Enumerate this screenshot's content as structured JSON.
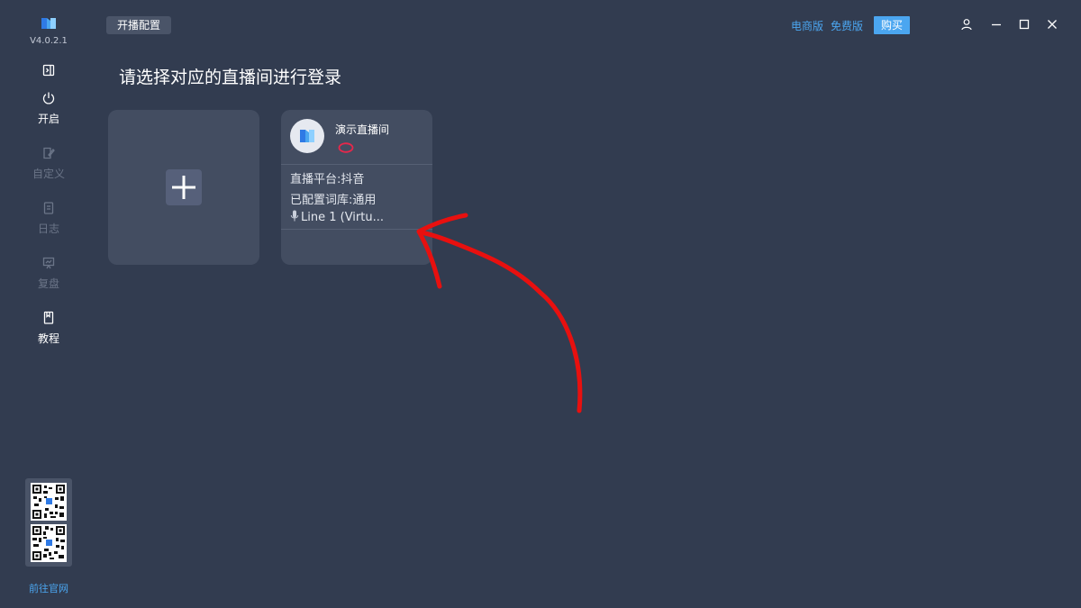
{
  "app": {
    "version": "V4.0.2.1"
  },
  "sidebar": {
    "items": [
      {
        "label": "开启",
        "state": "active"
      },
      {
        "label": "自定义",
        "state": "disabled"
      },
      {
        "label": "日志",
        "state": "disabled"
      },
      {
        "label": "复盘",
        "state": "disabled"
      },
      {
        "label": "教程",
        "state": "active"
      }
    ],
    "website_link": "前往官网"
  },
  "header": {
    "tab_label": "开播配置",
    "ecommerce_edition": "电商版",
    "free_edition": "免费版",
    "buy_label": "购买"
  },
  "main": {
    "title": "请选择对应的直播间进行登录",
    "room": {
      "name": "演示直播间",
      "platform": "直播平台:抖音",
      "library": "已配置词库:通用",
      "mic": "Line 1 (Virtu..."
    }
  },
  "colors": {
    "background": "#323c50",
    "card": "#434d61",
    "accent": "#4ba6f0",
    "annotation": "#e8100f"
  }
}
